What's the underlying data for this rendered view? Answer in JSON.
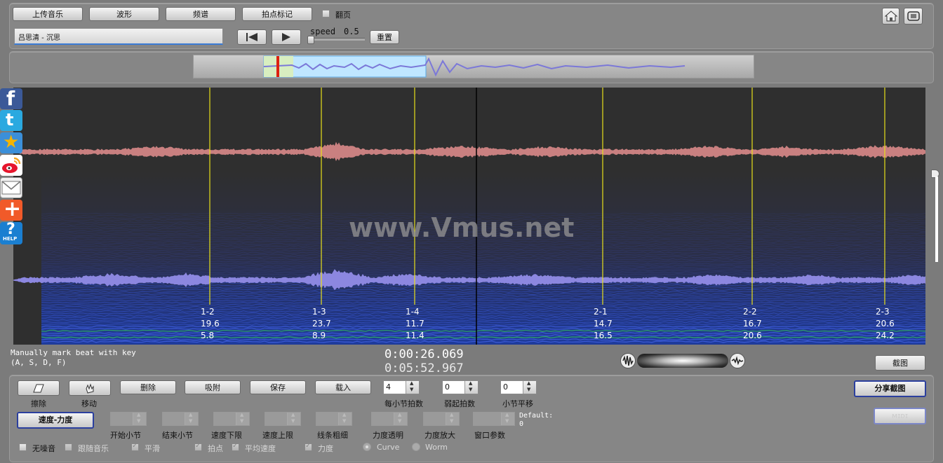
{
  "toolbar": {
    "upload_label": "上传音乐",
    "waveform_label": "波形",
    "spectrum_label": "频谱",
    "beat_mark_label": "拍点标记",
    "pageturn_label": "翻页",
    "song_title": "吕思清 - 沉思",
    "speed_label": "speed",
    "speed_value": "0.5",
    "reset_label": "重置"
  },
  "viewer": {
    "watermark": "www.Vmus.net",
    "beats": [
      {
        "label": "1-2",
        "v1": "19.6",
        "v2": "5.8",
        "pos": 0.215
      },
      {
        "label": "1-3",
        "v1": "23.7",
        "v2": "8.9",
        "pos": 0.338
      },
      {
        "label": "1-4",
        "v1": "11.7",
        "v2": "11.4",
        "pos": 0.44
      },
      {
        "label": "2-1",
        "v1": "14.7",
        "v2": "16.5",
        "pos": 0.646
      },
      {
        "label": "2-2",
        "v1": "16.7",
        "v2": "20.6",
        "pos": 0.81
      },
      {
        "label": "2-3",
        "v1": "20.6",
        "v2": "24.2",
        "pos": 0.955
      }
    ],
    "playhead_pos": 0.508
  },
  "status": {
    "hint_line1": "Manually mark beat with key",
    "hint_line2": "(A, S, D, F)",
    "current_time": "0:00:26.069",
    "total_time": "0:05:52.967",
    "screenshot_label": "截图"
  },
  "controls": {
    "erase_label": "擦除",
    "move_label": "移动",
    "delete_label": "删除",
    "snap_label": "吸附",
    "save_label": "保存",
    "load_label": "载入",
    "beats_per_bar": "4",
    "beats_per_bar_label": "每小节拍数",
    "pickup": "0",
    "pickup_label": "弱起拍数",
    "bar_shift": "0",
    "bar_shift_label": "小节平移",
    "share_label": "分享截图",
    "mode_label": "速度-力度",
    "start_bar_label": "开始小节",
    "end_bar_label": "结束小节",
    "speed_min_label": "速度下限",
    "speed_max_label": "速度上限",
    "line_width_label": "线条粗细",
    "force_alpha_label": "力度透明",
    "force_zoom_label": "力度放大",
    "window_param_label": "窗口参数",
    "default_label": "Default:",
    "default_value": "0",
    "midi_label": "ᴍɪᴅɪ"
  },
  "options": {
    "no_noise": "无噪音",
    "follow_music": "跟随音乐",
    "smooth": "平滑",
    "beat_point": "拍点",
    "avg_speed": "平均速度",
    "force": "力度",
    "curve": "Curve",
    "worm": "Worm"
  }
}
